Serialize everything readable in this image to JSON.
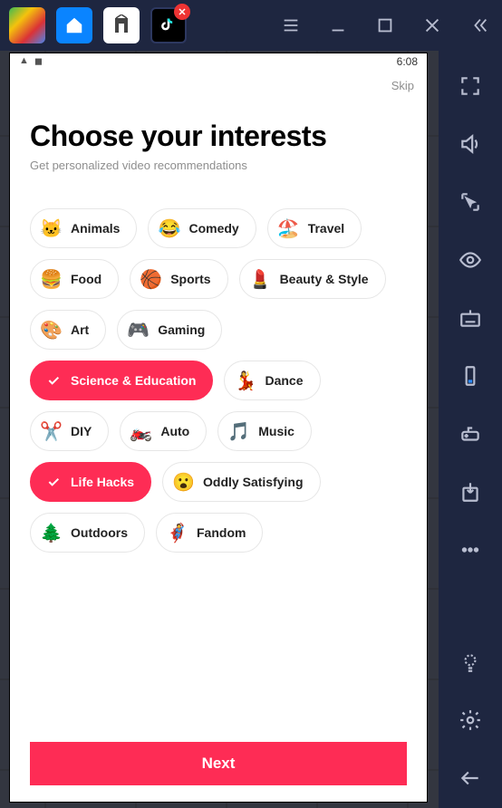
{
  "status": {
    "time": "6:08"
  },
  "skip_label": "Skip",
  "title": "Choose your interests",
  "subtitle": "Get personalized video recommendations",
  "interests": [
    {
      "label": "Animals",
      "emoji": "🐱",
      "selected": false
    },
    {
      "label": "Comedy",
      "emoji": "😂",
      "selected": false
    },
    {
      "label": "Travel",
      "emoji": "🏖️",
      "selected": false
    },
    {
      "label": "Food",
      "emoji": "🍔",
      "selected": false
    },
    {
      "label": "Sports",
      "emoji": "🏀",
      "selected": false
    },
    {
      "label": "Beauty & Style",
      "emoji": "💄",
      "selected": false
    },
    {
      "label": "Art",
      "emoji": "🎨",
      "selected": false
    },
    {
      "label": "Gaming",
      "emoji": "🎮",
      "selected": false
    },
    {
      "label": "Science & Education",
      "emoji": "🔬",
      "selected": true
    },
    {
      "label": "Dance",
      "emoji": "💃",
      "selected": false
    },
    {
      "label": "DIY",
      "emoji": "✂️",
      "selected": false
    },
    {
      "label": "Auto",
      "emoji": "🏍️",
      "selected": false
    },
    {
      "label": "Music",
      "emoji": "🎵",
      "selected": false
    },
    {
      "label": "Life Hacks",
      "emoji": "💡",
      "selected": true
    },
    {
      "label": "Oddly Satisfying",
      "emoji": "😮",
      "selected": false
    },
    {
      "label": "Outdoors",
      "emoji": "🌲",
      "selected": false
    },
    {
      "label": "Fandom",
      "emoji": "🦸",
      "selected": false
    }
  ],
  "next_label": "Next"
}
